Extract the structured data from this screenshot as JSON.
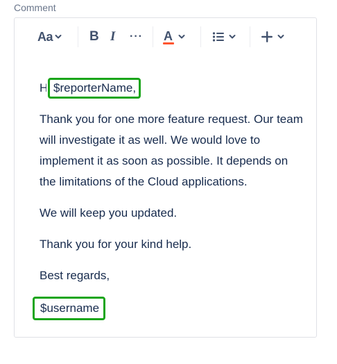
{
  "field": {
    "label": "Comment"
  },
  "toolbar": {
    "text_style_label": "Aa",
    "bold_label": "B",
    "italic_label": "I",
    "more_label": "···",
    "text_color_label": "A",
    "text_color_underline": "#ff5630",
    "insert_label": "+"
  },
  "body": {
    "greeting_prefix": "Hi",
    "greeting_variable": "$reporterName,",
    "paragraph1": "Thank you for one more feature request. Our team will investigate it as well. We would love to implement it as soon as possible. It depends on the limitations of the Cloud applications.",
    "paragraph2": "We will keep you updated.",
    "paragraph3": "Thank you for your kind help.",
    "closing": "Best regards,",
    "signature_variable": "$username"
  },
  "highlight_color": "#1aa51a"
}
